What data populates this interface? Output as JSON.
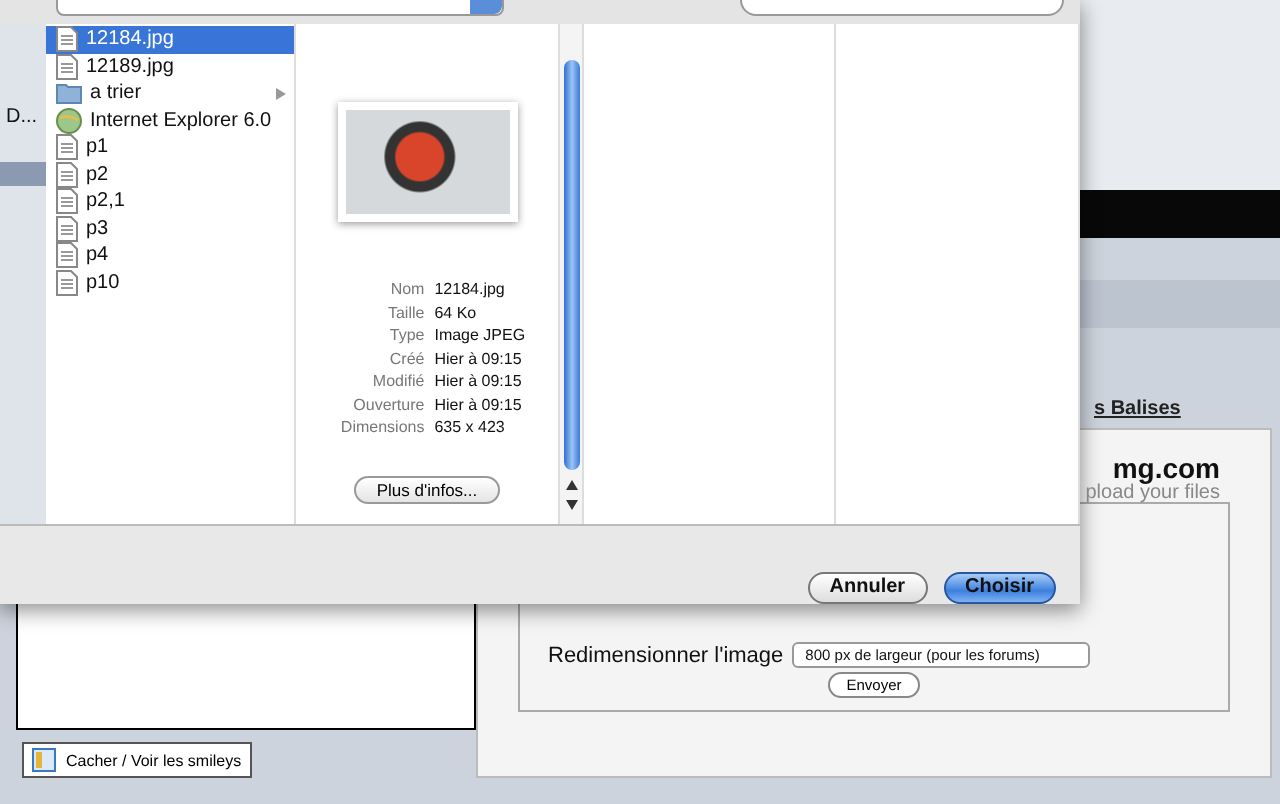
{
  "sidebar": {
    "items": [
      {
        "label": "D...",
        "selected": false
      },
      {
        "selected": true
      }
    ]
  },
  "files": [
    {
      "name": "12184.jpg",
      "kind": "file",
      "selected": true,
      "expandable": false
    },
    {
      "name": "12189.jpg",
      "kind": "file",
      "selected": false,
      "expandable": false
    },
    {
      "name": "a trier",
      "kind": "folder",
      "selected": false,
      "expandable": true
    },
    {
      "name": "Internet Explorer 6.0",
      "kind": "app",
      "selected": false,
      "expandable": false
    },
    {
      "name": "p1",
      "kind": "file",
      "selected": false,
      "expandable": false
    },
    {
      "name": "p2",
      "kind": "file",
      "selected": false,
      "expandable": false
    },
    {
      "name": "p2,1",
      "kind": "file",
      "selected": false,
      "expandable": false
    },
    {
      "name": "p3",
      "kind": "file",
      "selected": false,
      "expandable": false
    },
    {
      "name": "p4",
      "kind": "file",
      "selected": false,
      "expandable": false
    },
    {
      "name": "p10",
      "kind": "file",
      "selected": false,
      "expandable": false
    }
  ],
  "preview": {
    "info": [
      {
        "label": "Nom",
        "value": "12184.jpg"
      },
      {
        "label": "Taille",
        "value": "64 Ko"
      },
      {
        "label": "Type",
        "value": "Image JPEG"
      },
      {
        "label": "Créé",
        "value": "Hier à 09:15"
      },
      {
        "label": "Modifié",
        "value": "Hier à 09:15"
      },
      {
        "label": "Ouverture",
        "value": "Hier à 09:15"
      },
      {
        "label": "Dimensions",
        "value": "635 x 423"
      }
    ],
    "more_button": "Plus d'infos..."
  },
  "buttons": [
    {
      "label": "Annuler",
      "default": false
    },
    {
      "label": "Choisir",
      "default": true
    }
  ],
  "web_page": {
    "tab_link": "s Balises",
    "logo": "mg.com",
    "tagline": "pload your files",
    "resize_label": "Redimensionner l'image",
    "resize_select": "800 px de largeur (pour les forums)",
    "submit": "Envoyer",
    "smileys_button": "Cacher / Voir les smileys"
  }
}
